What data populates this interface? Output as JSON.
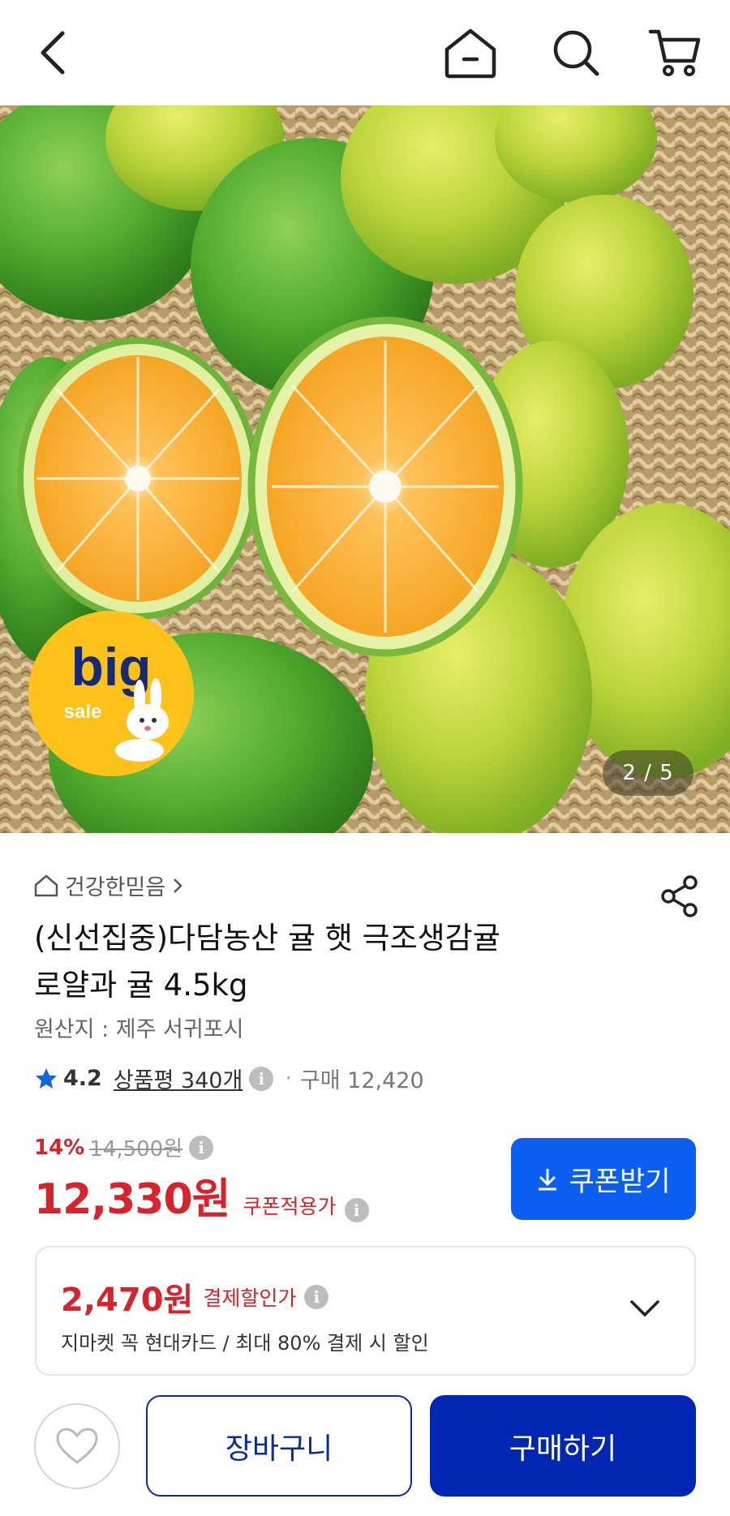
{
  "header": {
    "back_icon": "chevron-left-icon",
    "home_icon": "home-icon",
    "search_icon": "search-icon",
    "cart_icon": "cart-icon"
  },
  "gallery": {
    "badge_title": "big",
    "badge_sub": "sale",
    "counter": "2 / 5"
  },
  "product": {
    "seller": "건강한믿음",
    "title_line1": "(신선집중)다담농산 귤 햇 극조생감귤",
    "title_line2": "로얄과 귤 4.5kg",
    "origin": "원산지 : 제주 서귀포시",
    "rating": "4.2",
    "reviews": "상품평 340개",
    "purchase": "구매 12,420"
  },
  "price": {
    "discount_rate": "14%",
    "original_price": "14,500원",
    "sale_price": "12,330원",
    "sale_label": "쿠폰적용가",
    "info_mark": "i"
  },
  "coupon": {
    "label": "쿠폰받기"
  },
  "payment": {
    "price": "2,470원",
    "label": "결제할인가",
    "description": "지마켓 꼭 현대카드 / 최대 80% 결제 시 할인"
  },
  "actions": {
    "cart_label": "장바구니",
    "buy_label": "구매하기"
  },
  "colors": {
    "price_red": "#d9222a",
    "coupon_blue": "#0a5ff2",
    "buy_navy": "#0027b3",
    "star_blue": "#1565e0"
  }
}
